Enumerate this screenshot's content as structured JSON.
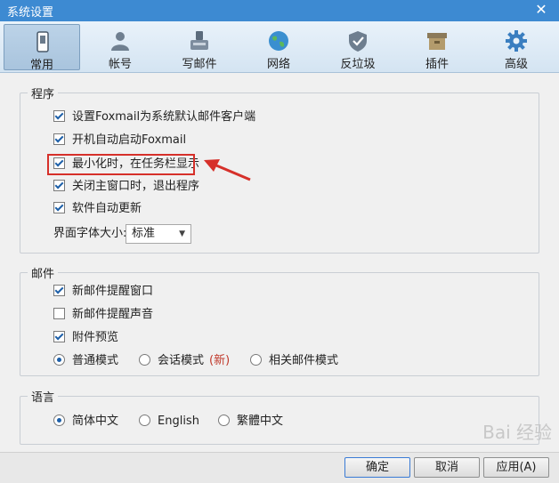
{
  "window": {
    "title": "系统设置",
    "close_glyph": "✕"
  },
  "toolbar": {
    "items": [
      {
        "label": "常用",
        "icon": "phone-icon",
        "active": true
      },
      {
        "label": "帐号",
        "icon": "user-icon"
      },
      {
        "label": "写邮件",
        "icon": "write-icon"
      },
      {
        "label": "网络",
        "icon": "globe-icon"
      },
      {
        "label": "反垃圾",
        "icon": "shield-icon"
      },
      {
        "label": "插件",
        "icon": "box-icon"
      },
      {
        "label": "高级",
        "icon": "gear-icon"
      }
    ]
  },
  "program": {
    "legend": "程序",
    "options": [
      {
        "label": "设置Foxmail为系统默认邮件客户端",
        "checked": true
      },
      {
        "label": "开机自动启动Foxmail",
        "checked": true
      },
      {
        "label": "最小化时，在任务栏显示",
        "checked": true
      },
      {
        "label": "关闭主窗口时，退出程序",
        "checked": true
      },
      {
        "label": "软件自动更新",
        "checked": true
      }
    ],
    "font_size_label": "界面字体大小:",
    "font_size_value": "标准"
  },
  "mail": {
    "legend": "邮件",
    "options": [
      {
        "label": "新邮件提醒窗口",
        "checked": true
      },
      {
        "label": "新邮件提醒声音",
        "checked": false
      },
      {
        "label": "附件预览",
        "checked": true
      }
    ],
    "modes": [
      {
        "label": "普通模式",
        "checked": true
      },
      {
        "label": "会话模式",
        "checked": false,
        "tag": "(新)"
      },
      {
        "label": "相关邮件模式",
        "checked": false
      }
    ]
  },
  "language": {
    "legend": "语言",
    "options": [
      {
        "label": "简体中文",
        "checked": true
      },
      {
        "label": "English",
        "checked": false
      },
      {
        "label": "繁體中文",
        "checked": false
      }
    ]
  },
  "buttons": {
    "ok": "确定",
    "cancel": "取消",
    "apply": "应用(A)"
  },
  "annotation": {
    "highlight_color": "#d6302a"
  },
  "watermark": "Bai 经验"
}
